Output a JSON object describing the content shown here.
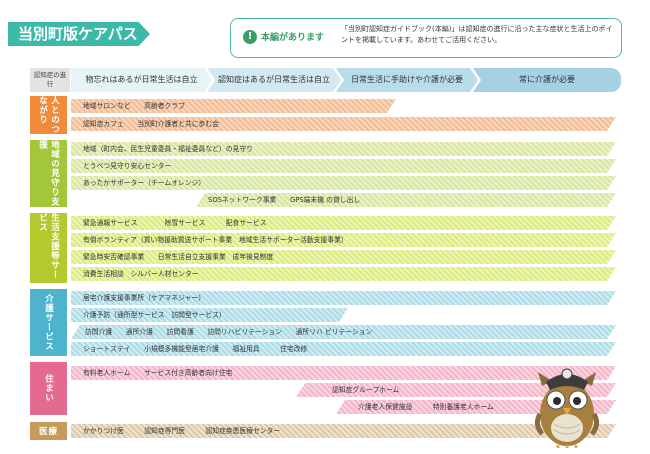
{
  "title": "当別町版ケアパス",
  "notice": {
    "heading": "本編があります",
    "description": "「当別町認知症ガイドブック(本編)」は認知症の進行に沿った主な症状と生活上のポイントを掲載しています。あわせてご活用ください。"
  },
  "stages": {
    "label": "認知症の進 行",
    "items": [
      "物忘れはあるが日常生活は自立",
      "認知症はあるが日常生活は自立",
      "日常生活に手助けや介護が必要",
      "常に介護が必要"
    ]
  },
  "categories": [
    {
      "label": "人とのつながり",
      "color": "#f08b3c"
    },
    {
      "label": "地域の見守り支援",
      "color": "#a4c739"
    },
    {
      "label": "生活支援等サービス",
      "color": "#b5c92f"
    },
    {
      "label": "介護サービス",
      "color": "#4eb3cd"
    },
    {
      "label": "住まい",
      "color": "#e46b8f"
    },
    {
      "label": "医療",
      "color": "#c69a5a"
    }
  ],
  "bars": [
    "地域サロンなど　　高齢者クラブ",
    "認知症カフェ　　当別町介護者と共に歩む会",
    "地域（町内会、民生児童委員・福祉委員など）の見守り",
    "とうべつ見守り安心センター",
    "あったかサポーター（チームオレンジ）",
    "SOSネットワーク事業　　GPS端末機 の貸し出し",
    "緊急通報サービス　　　　除雪サービス　　　配食サービス",
    "有償ボランティア（買い物援助買送サポート事業　地域生活サポーター活動支援事業）",
    "緊急時安否確認事業　　日常生活自立支援事業　成年後見制度",
    "消費生活相談　シルバー人材センター",
    "居宅介護支援事業所（ケアマネジャー）",
    "介護予防（通所型サービス　訪問型サービス）",
    "訪問介護　　通所介護　　訪問看護　　訪問リハビリテーション　　通所リハ ビリテーション",
    "ショートステイ　　小規模多機能型居宅介護　　福祉用具　　　住宅改修",
    "有料老人ホーム　　サービス付き高齢者向け住宅",
    "認知症グループホーム",
    "介護老人保健施設　　　特別養護老人ホーム",
    "かかりつけ医　　　認知症専門医　　　認知症疾患医療センター"
  ],
  "colors": {
    "teal": "#3cb9a8",
    "green_notice": "#3a9e68"
  }
}
